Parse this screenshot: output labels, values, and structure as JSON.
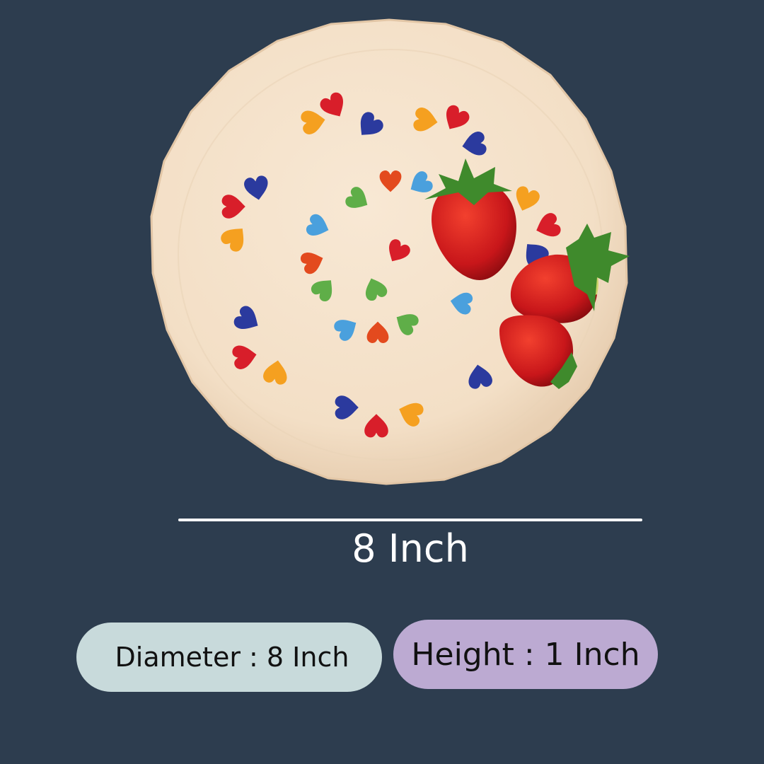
{
  "product": {
    "image_alt": "Hand-painted heart pattern plate with strawberries",
    "measurement_label": "8 Inch",
    "diameter_label": "Diameter : 8 Inch",
    "height_label": "Height : 1 Inch"
  },
  "colors": {
    "background": "#2d3d4f",
    "plate": "#f5e3cc",
    "diameter_pill": "#c8dadb",
    "height_pill": "#bcaad2",
    "line": "#ffffff"
  }
}
